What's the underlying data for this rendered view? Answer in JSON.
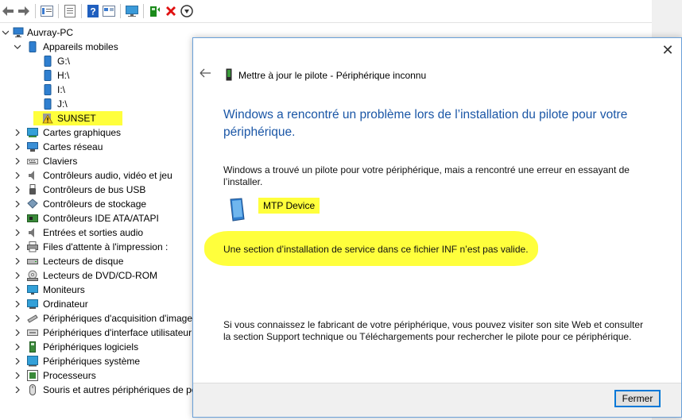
{
  "toolbar": {
    "icons": [
      "back-arrow-icon",
      "forward-arrow-icon",
      "properties-icon",
      "list-icon",
      "help-icon",
      "view-icon",
      "monitor-icon",
      "update-driver-icon",
      "uninstall-icon",
      "disable-icon"
    ],
    "colors": {
      "help": "#1f5fbf",
      "uninstall": "#e01010",
      "update": "#1a8a1a"
    }
  },
  "tree": {
    "root": "Auvray-PC",
    "mobile": {
      "label": "Appareils mobiles",
      "children": [
        "G:\\",
        "H:\\",
        "I:\\",
        "J:\\"
      ],
      "highlighted": "SUNSET"
    },
    "categories": [
      "Cartes graphiques",
      "Cartes réseau",
      "Claviers",
      "Contrôleurs audio, vidéo et jeu",
      "Contrôleurs de bus USB",
      "Contrôleurs de stockage",
      "Contrôleurs IDE ATA/ATAPI",
      "Entrées et sorties audio",
      "Files d'attente à l'impression :",
      "Lecteurs de disque",
      "Lecteurs de DVD/CD-ROM",
      "Moniteurs",
      "Ordinateur",
      "Périphériques d'acquisition d'images",
      "Périphériques d'interface utilisateur",
      "Périphériques logiciels",
      "Périphériques système",
      "Processeurs",
      "Souris et autres périphériques de po"
    ]
  },
  "dialog": {
    "title": "Mettre à jour le pilote - Périphérique inconnu",
    "headline": "Windows a rencontré un problème lors de l’installation du pilote pour votre périphérique.",
    "found_text": "Windows a trouvé un pilote pour votre périphérique, mais a rencontré une erreur en essayant de l’installer.",
    "device_name": "MTP Device",
    "error_text": "Une section d’installation de service dans ce fichier INF n’est pas valide.",
    "help_text": "Si vous connaissez le fabricant de votre périphérique, vous pouvez visiter son site Web et consulter la section Support technique ou Téléchargements pour rechercher le pilote pour ce périphérique.",
    "close_label": "Fermer"
  }
}
